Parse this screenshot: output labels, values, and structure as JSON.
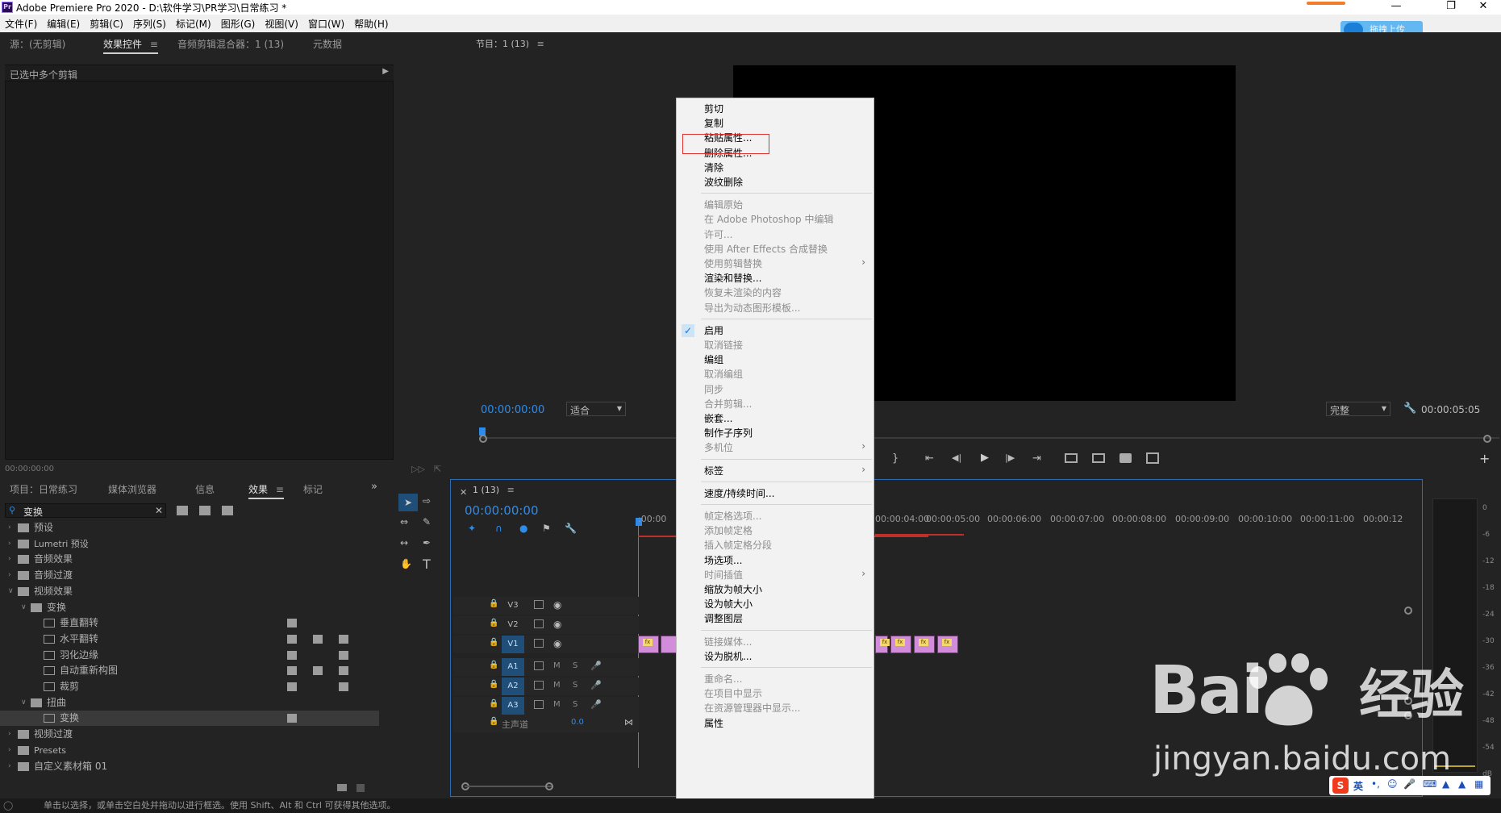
{
  "window": {
    "title": "Adobe Premiere Pro 2020 - D:\\软件学习\\PR学习\\日常练习 *",
    "controls": [
      "minimize",
      "maximize",
      "close"
    ]
  },
  "menu": {
    "items": [
      "文件(F)",
      "编辑(E)",
      "剪辑(C)",
      "序列(S)",
      "标记(M)",
      "图形(G)",
      "视图(V)",
      "窗口(W)",
      "帮助(H)"
    ]
  },
  "upload_button": "拖拽上传",
  "source_panel": {
    "tabs": [
      "源：(无剪辑)",
      "效果控件",
      "音频剪辑混合器：1 (13)",
      "元数据"
    ],
    "active_tab": "效果控件",
    "header": "已选中多个剪辑",
    "timecode": "00:00:00:00"
  },
  "program_monitor": {
    "tab": "节目：1 (13)",
    "timecode_left": "00:00:00:00",
    "fit": "适合",
    "quality": "完整",
    "timecode_right": "00:00:05:05"
  },
  "project_panel": {
    "tabs": [
      "项目：日常练习",
      "媒体浏览器",
      "信息",
      "效果",
      "标记"
    ],
    "active_tab": "效果",
    "search_value": "变换",
    "tree": [
      {
        "label": "预设",
        "level": 0,
        "type": "folder",
        "open": false
      },
      {
        "label": "Lumetri 预设",
        "level": 0,
        "type": "folder",
        "open": false
      },
      {
        "label": "音频效果",
        "level": 0,
        "type": "folder",
        "open": false
      },
      {
        "label": "音频过渡",
        "level": 0,
        "type": "folder",
        "open": false
      },
      {
        "label": "视频效果",
        "level": 0,
        "type": "folder",
        "open": true
      },
      {
        "label": "变换",
        "level": 1,
        "type": "folder",
        "open": true
      },
      {
        "label": "垂直翻转",
        "level": 2,
        "type": "effect"
      },
      {
        "label": "水平翻转",
        "level": 2,
        "type": "effect"
      },
      {
        "label": "羽化边缘",
        "level": 2,
        "type": "effect"
      },
      {
        "label": "自动重新构图",
        "level": 2,
        "type": "effect"
      },
      {
        "label": "裁剪",
        "level": 2,
        "type": "effect"
      },
      {
        "label": "扭曲",
        "level": 1,
        "type": "folder",
        "open": true
      },
      {
        "label": "变换",
        "level": 2,
        "type": "effect",
        "selected": true
      },
      {
        "label": "视频过渡",
        "level": 0,
        "type": "folder",
        "open": false
      },
      {
        "label": "Presets",
        "level": 0,
        "type": "folder",
        "open": false
      },
      {
        "label": "自定义素材箱 01",
        "level": 0,
        "type": "folder",
        "open": false
      }
    ]
  },
  "timeline": {
    "tab": "1 (13)",
    "timecode": "00:00:00:00",
    "ruler": [
      ":00:00",
      "00:00:04:00",
      "00:00:05:00",
      "00:00:06:00",
      "00:00:07:00",
      "00:00:08:00",
      "00:00:09:00",
      "00:00:10:00",
      "00:00:11:00",
      "00:00:12"
    ],
    "tracks": [
      "V3",
      "V2",
      "V1",
      "A1",
      "A2",
      "A3"
    ],
    "master_label": "主声道",
    "master_value": "0.0",
    "mute": "M",
    "solo": "S"
  },
  "meter": {
    "labels": [
      "0",
      "-6",
      "-12",
      "-18",
      "-24",
      "-30",
      "-36",
      "-42",
      "-48",
      "-54",
      "dB"
    ]
  },
  "context_menu": {
    "items": [
      {
        "label": "剪切",
        "enabled": true
      },
      {
        "label": "复制",
        "enabled": true
      },
      {
        "label": "粘贴属性...",
        "enabled": true,
        "highlighted": true
      },
      {
        "label": "删除属性...",
        "enabled": true
      },
      {
        "label": "清除",
        "enabled": true
      },
      {
        "label": "波纹删除",
        "enabled": true
      },
      {
        "sep": true
      },
      {
        "label": "编辑原始",
        "enabled": false
      },
      {
        "label": "在 Adobe Photoshop 中编辑",
        "enabled": false
      },
      {
        "label": "许可...",
        "enabled": false
      },
      {
        "label": "使用 After Effects 合成替换",
        "enabled": false
      },
      {
        "label": "使用剪辑替换",
        "enabled": false,
        "submenu": true
      },
      {
        "label": "渲染和替换...",
        "enabled": true
      },
      {
        "label": "恢复未渲染的内容",
        "enabled": false
      },
      {
        "label": "导出为动态图形模板...",
        "enabled": false
      },
      {
        "sep": true
      },
      {
        "label": "启用",
        "enabled": true,
        "checked": true
      },
      {
        "label": "取消链接",
        "enabled": false
      },
      {
        "label": "编组",
        "enabled": true
      },
      {
        "label": "取消编组",
        "enabled": false
      },
      {
        "label": "同步",
        "enabled": false
      },
      {
        "label": "合并剪辑...",
        "enabled": false
      },
      {
        "label": "嵌套...",
        "enabled": true
      },
      {
        "label": "制作子序列",
        "enabled": true
      },
      {
        "label": "多机位",
        "enabled": false,
        "submenu": true
      },
      {
        "sep": true
      },
      {
        "label": "标签",
        "enabled": true,
        "submenu": true
      },
      {
        "sep": true
      },
      {
        "label": "速度/持续时间...",
        "enabled": true
      },
      {
        "sep": true
      },
      {
        "label": "帧定格选项...",
        "enabled": false
      },
      {
        "label": "添加帧定格",
        "enabled": false
      },
      {
        "label": "插入帧定格分段",
        "enabled": false
      },
      {
        "label": "场选项...",
        "enabled": true
      },
      {
        "label": "时间插值",
        "enabled": false,
        "submenu": true
      },
      {
        "label": "缩放为帧大小",
        "enabled": true
      },
      {
        "label": "设为帧大小",
        "enabled": true
      },
      {
        "label": "调整图层",
        "enabled": true
      },
      {
        "sep": true
      },
      {
        "label": "链接媒体...",
        "enabled": false
      },
      {
        "label": "设为脱机...",
        "enabled": true
      },
      {
        "sep": true
      },
      {
        "label": "重命名...",
        "enabled": false
      },
      {
        "label": "在项目中显示",
        "enabled": false
      },
      {
        "label": "在资源管理器中显示...",
        "enabled": false
      },
      {
        "label": "属性",
        "enabled": true
      }
    ]
  },
  "status_bar": "单击以选择，或单击空白处并拖动以进行框选。使用 Shift、Alt 和 Ctrl 可获得其他选项。",
  "watermark": {
    "line1": "Bai",
    "line1b": "经验",
    "line2": "jingyan.baidu.com"
  },
  "ime": {
    "lang": "英"
  },
  "colors": {
    "accent": "#2d8ceb",
    "highlight_box": "#e03030",
    "selected_track": "#1f4e79",
    "clip": "#d18dd9"
  }
}
